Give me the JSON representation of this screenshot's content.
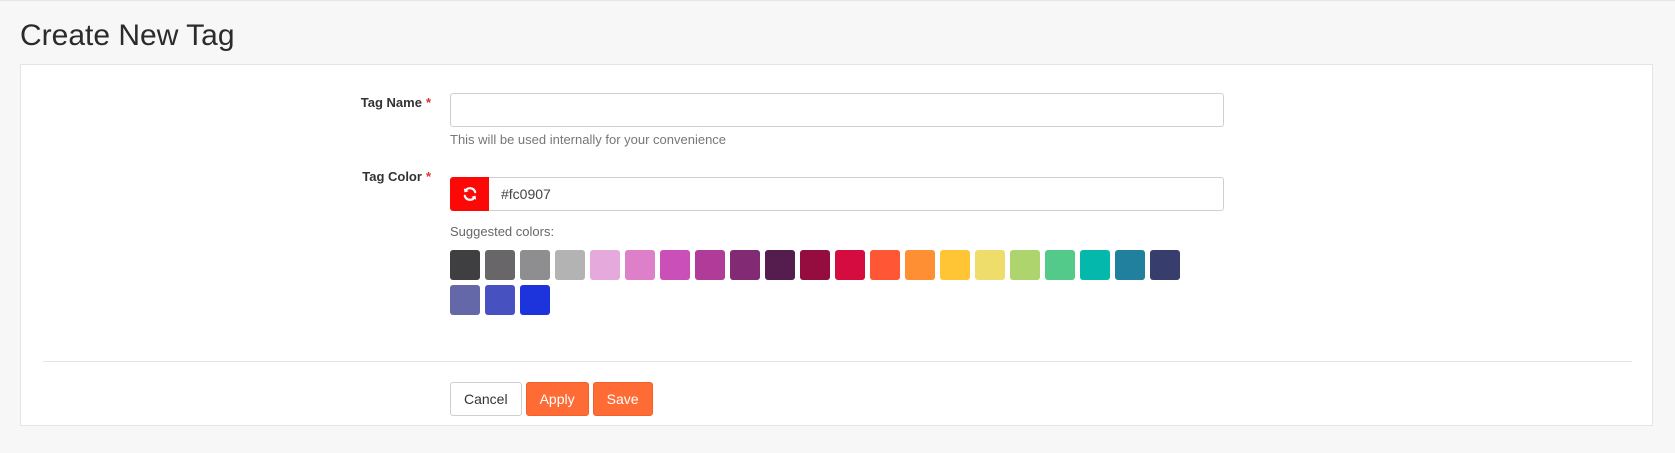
{
  "page": {
    "title": "Create New Tag"
  },
  "tag_name": {
    "label": "Tag Name",
    "required_mark": "*",
    "value": "",
    "help": "This will be used internally for your convenience"
  },
  "tag_color": {
    "label": "Tag Color",
    "required_mark": "*",
    "value": "#fc0907",
    "refresh_icon": "refresh-icon",
    "button_color": "#fc0907"
  },
  "suggested": {
    "label": "Suggested colors:",
    "colors": [
      "#3f3f41",
      "#686668",
      "#8e8d8f",
      "#b3b3b4",
      "#e5a9dc",
      "#de80c9",
      "#cb4fb8",
      "#b03b98",
      "#822a73",
      "#541d4d",
      "#940d3e",
      "#d40c3f",
      "#ff5635",
      "#ff8f33",
      "#ffc535",
      "#eedd6b",
      "#add46d",
      "#53c98a",
      "#04b8ac",
      "#20809d",
      "#373e6d",
      "#6568a8",
      "#4751bf",
      "#1d34dd"
    ]
  },
  "actions": {
    "cancel_label": "Cancel",
    "apply_label": "Apply",
    "save_label": "Save"
  }
}
